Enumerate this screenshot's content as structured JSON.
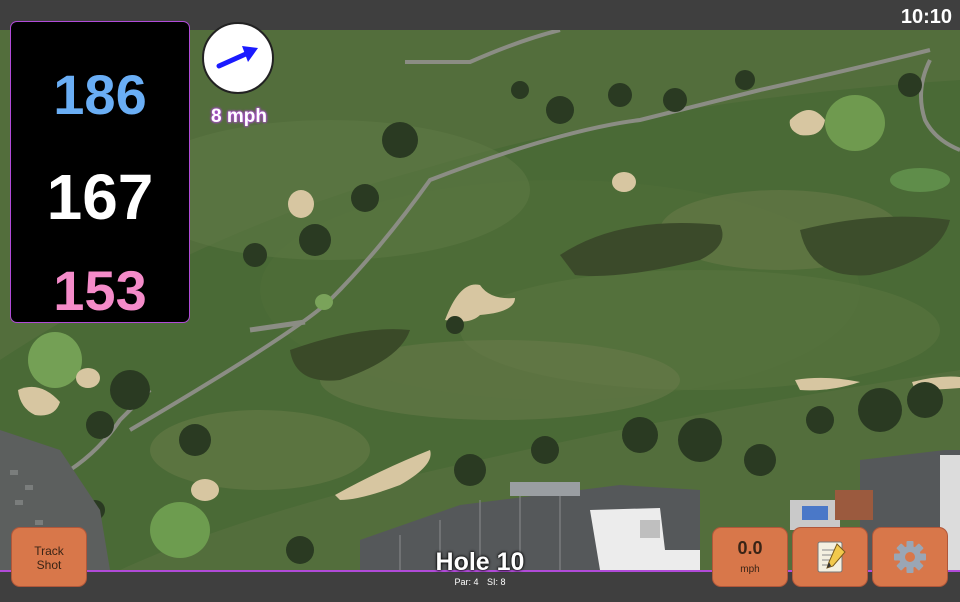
{
  "status_bar": {
    "time": "10:10"
  },
  "distances": {
    "back": "186",
    "center": "167",
    "front": "153",
    "colors": {
      "back": "#6aaef5",
      "center": "#ffffff",
      "front": "#f48bc9"
    }
  },
  "wind": {
    "speed": "8 mph",
    "direction_icon": "arrow-icon",
    "arrow_color": "#1a1aff"
  },
  "hole": {
    "title": "Hole 10",
    "par": "Par: 4",
    "si": "SI: 8"
  },
  "buttons": {
    "track_shot_line1": "Track",
    "track_shot_line2": "Shot",
    "speed_value": "0.0",
    "speed_unit": "mph",
    "notes_icon": "notepad-icon",
    "settings_icon": "gear-icon"
  },
  "colors": {
    "accent": "#b14bd8",
    "button": "#d8774a",
    "bar": "#3f3f3f"
  }
}
